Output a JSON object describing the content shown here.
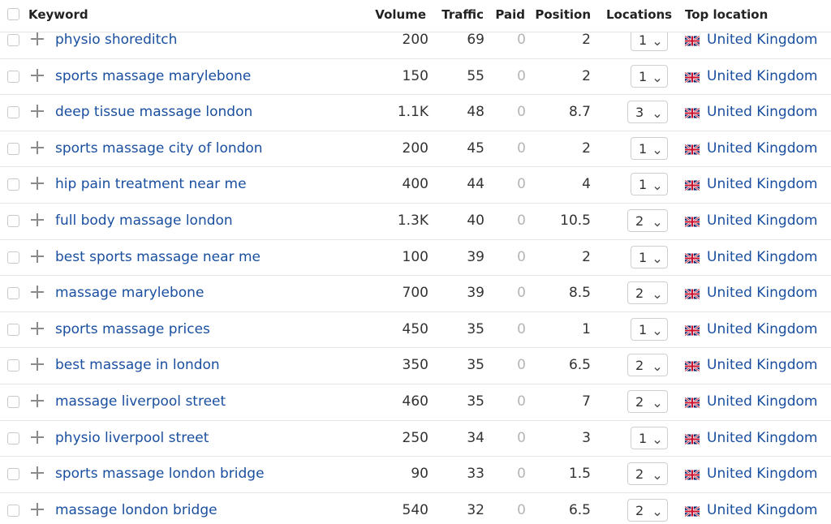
{
  "header": {
    "keyword": "Keyword",
    "volume": "Volume",
    "traffic": "Traffic",
    "paid": "Paid",
    "position": "Position",
    "locations": "Locations",
    "top_location": "Top location"
  },
  "rows": [
    {
      "keyword": "physio shoreditch",
      "volume": "200",
      "traffic": "69",
      "paid": "0",
      "position": "2",
      "locations": "1",
      "top_location": "United Kingdom"
    },
    {
      "keyword": "sports massage marylebone",
      "volume": "150",
      "traffic": "55",
      "paid": "0",
      "position": "2",
      "locations": "1",
      "top_location": "United Kingdom"
    },
    {
      "keyword": "deep tissue massage london",
      "volume": "1.1K",
      "traffic": "48",
      "paid": "0",
      "position": "8.7",
      "locations": "3",
      "top_location": "United Kingdom"
    },
    {
      "keyword": "sports massage city of london",
      "volume": "200",
      "traffic": "45",
      "paid": "0",
      "position": "2",
      "locations": "1",
      "top_location": "United Kingdom"
    },
    {
      "keyword": "hip pain treatment near me",
      "volume": "400",
      "traffic": "44",
      "paid": "0",
      "position": "4",
      "locations": "1",
      "top_location": "United Kingdom"
    },
    {
      "keyword": "full body massage london",
      "volume": "1.3K",
      "traffic": "40",
      "paid": "0",
      "position": "10.5",
      "locations": "2",
      "top_location": "United Kingdom"
    },
    {
      "keyword": "best sports massage near me",
      "volume": "100",
      "traffic": "39",
      "paid": "0",
      "position": "2",
      "locations": "1",
      "top_location": "United Kingdom"
    },
    {
      "keyword": "massage marylebone",
      "volume": "700",
      "traffic": "39",
      "paid": "0",
      "position": "8.5",
      "locations": "2",
      "top_location": "United Kingdom"
    },
    {
      "keyword": "sports massage prices",
      "volume": "450",
      "traffic": "35",
      "paid": "0",
      "position": "1",
      "locations": "1",
      "top_location": "United Kingdom"
    },
    {
      "keyword": "best massage in london",
      "volume": "350",
      "traffic": "35",
      "paid": "0",
      "position": "6.5",
      "locations": "2",
      "top_location": "United Kingdom"
    },
    {
      "keyword": "massage liverpool street",
      "volume": "460",
      "traffic": "35",
      "paid": "0",
      "position": "7",
      "locations": "2",
      "top_location": "United Kingdom"
    },
    {
      "keyword": "physio liverpool street",
      "volume": "250",
      "traffic": "34",
      "paid": "0",
      "position": "3",
      "locations": "1",
      "top_location": "United Kingdom"
    },
    {
      "keyword": "sports massage london bridge",
      "volume": "90",
      "traffic": "33",
      "paid": "0",
      "position": "1.5",
      "locations": "2",
      "top_location": "United Kingdom"
    },
    {
      "keyword": "massage london bridge",
      "volume": "540",
      "traffic": "32",
      "paid": "0",
      "position": "6.5",
      "locations": "2",
      "top_location": "United Kingdom"
    }
  ],
  "colors": {
    "link": "#1a4fa0",
    "paid_zero": "#b5b5b5",
    "border": "#e6e6e6"
  },
  "icons": {
    "row_add": "plus-icon",
    "dropdown": "chevron-down-icon",
    "flag": "uk-flag-icon"
  }
}
